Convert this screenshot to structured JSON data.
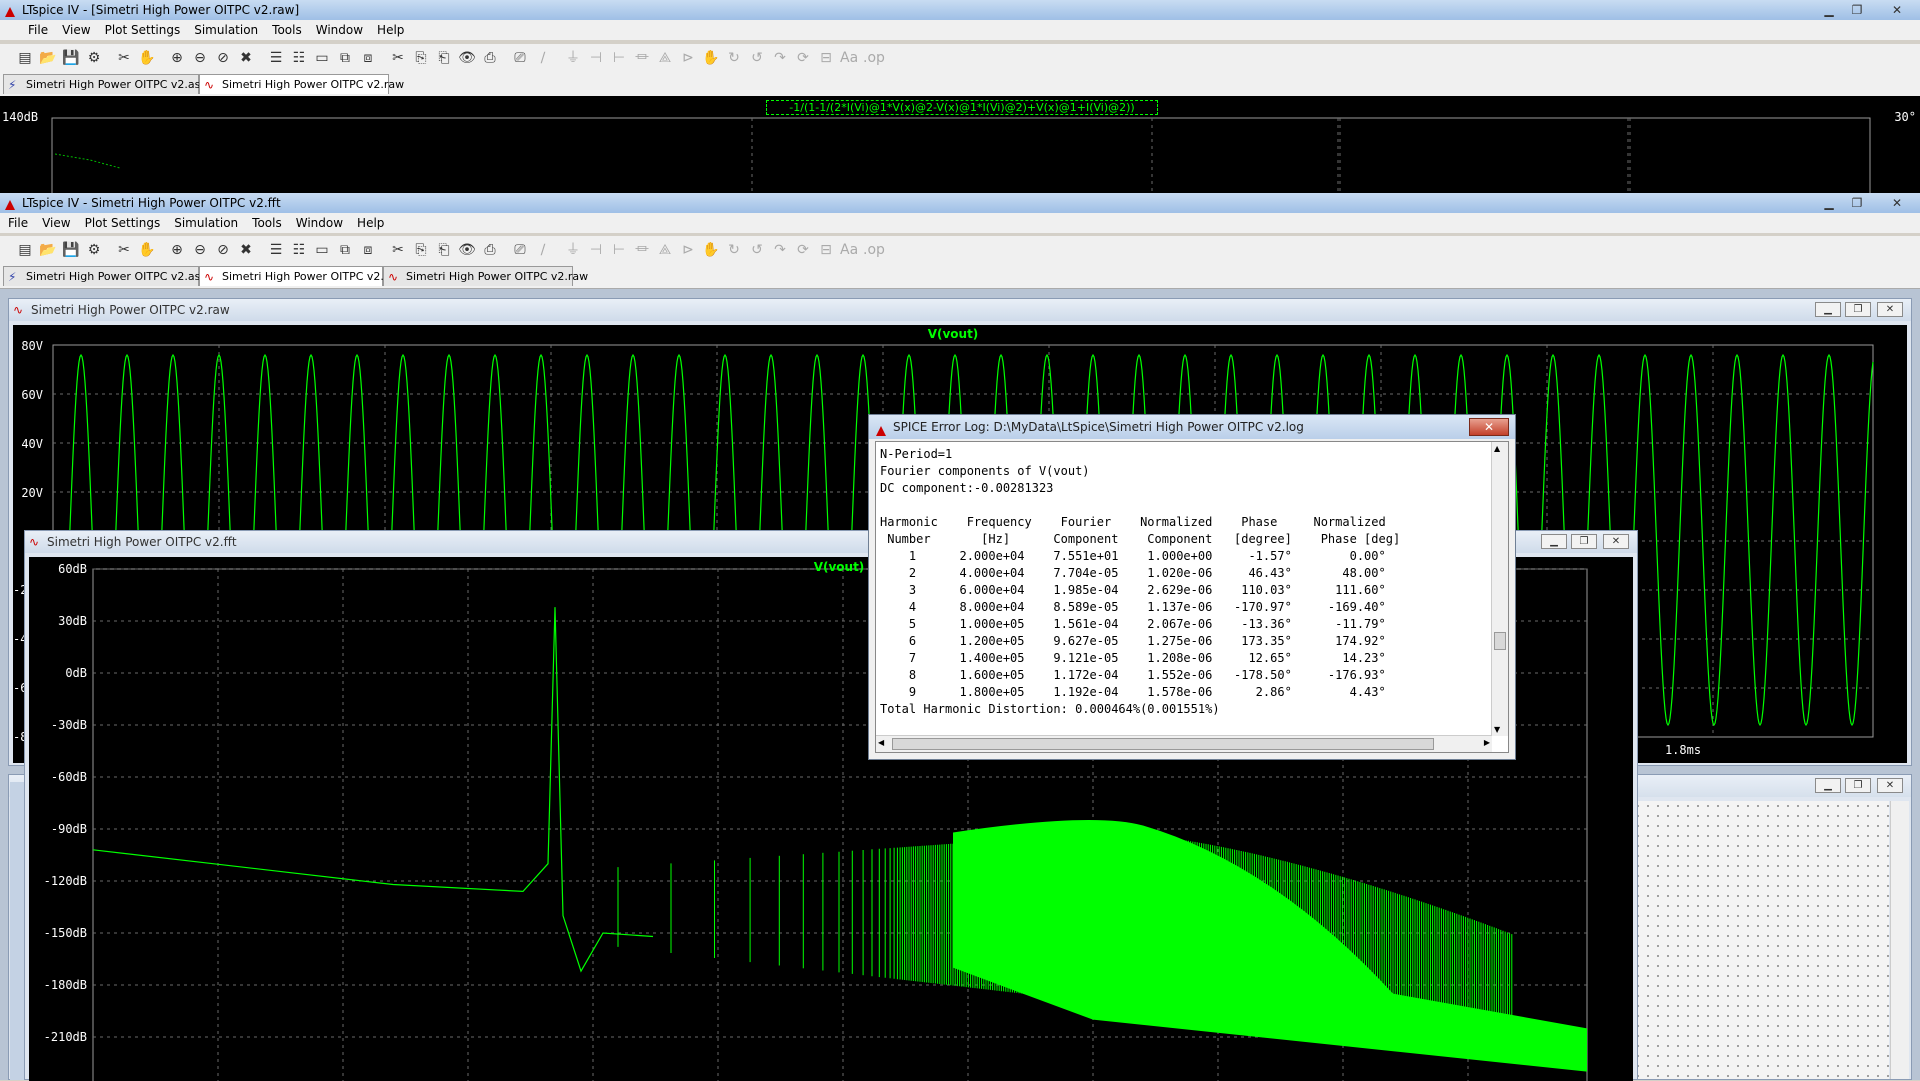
{
  "window1": {
    "title": "LTspice IV - [Simetri High Power OITPC v2.raw]",
    "menus": [
      "File",
      "View",
      "Plot Settings",
      "Simulation",
      "Tools",
      "Window",
      "Help"
    ],
    "tabs": [
      "Simetri High Power OITPC v2.asc",
      "Simetri High Power OITPC v2.raw"
    ],
    "trace_expr": "-1/(1-1/(2*I(Vi)@1*V(x)@2-V(x)@1*I(Vi)@2)+V(x)@1+I(Vi)@2))",
    "y_left": "140dB",
    "y_right": "30°"
  },
  "window2": {
    "title": "LTspice IV - Simetri High Power OITPC v2.fft",
    "menus": [
      "File",
      "View",
      "Plot Settings",
      "Simulation",
      "Tools",
      "Window",
      "Help"
    ],
    "tabs": [
      "Simetri High Power OITPC v2.asc",
      "Simetri High Power OITPC v2.fft",
      "Simetri High Power OITPC v2.raw"
    ]
  },
  "raw_window": {
    "title": "Simetri High Power OITPC v2.raw",
    "trace": "V(vout)",
    "ylabels": [
      "80V",
      "60V",
      "40V",
      "20V"
    ],
    "partial_labels": [
      "-2",
      "-4",
      "-6",
      "-8"
    ],
    "xlabel": "1.8ms"
  },
  "fft_window": {
    "title": "Simetri High Power OITPC v2.fft",
    "trace": "V(vout)",
    "ylabels": [
      "60dB",
      "30dB",
      "0dB",
      "-30dB",
      "-60dB",
      "-90dB",
      "-120dB",
      "-150dB",
      "-180dB",
      "-210dB"
    ]
  },
  "log": {
    "title": "SPICE Error Log: D:\\MyData\\LtSpice\\Simetri High Power OITPC v2.log",
    "close": "✕",
    "lines": [
      "N-Period=1",
      "Fourier components of V(vout)",
      "DC component:-0.00281323",
      "",
      "Harmonic    Frequency    Fourier    Normalized    Phase     Normalized",
      " Number       [Hz]      Component    Component   [degree]    Phase [deg]",
      "    1      2.000e+04    7.551e+01    1.000e+00     -1.57°        0.00°",
      "    2      4.000e+04    7.704e-05    1.020e-06     46.43°       48.00°",
      "    3      6.000e+04    1.985e-04    2.629e-06    110.03°      111.60°",
      "    4      8.000e+04    8.589e-05    1.137e-06   -170.97°     -169.40°",
      "    5      1.000e+05    1.561e-04    2.067e-06    -13.36°      -11.79°",
      "    6      1.200e+05    9.627e-05    1.275e-06    173.35°      174.92°",
      "    7      1.400e+05    9.121e-05    1.208e-06     12.65°       14.23°",
      "    8      1.600e+05    1.172e-04    1.552e-06   -178.50°     -176.93°",
      "    9      1.800e+05    1.192e-04    1.578e-06      2.86°        4.43°",
      "Total Harmonic Distortion: 0.000464%(0.001551%)"
    ]
  },
  "colors": {
    "trace": "#00ff00",
    "plot_bg": "#000000",
    "grid": "#808080"
  }
}
